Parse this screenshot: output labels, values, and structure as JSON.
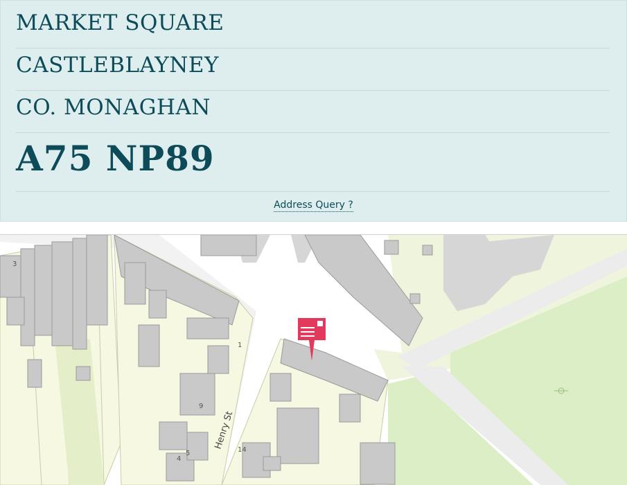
{
  "address": {
    "line1": "MARKET SQUARE",
    "line2": "CASTLEBLAYNEY",
    "line3": "CO. MONAGHAN",
    "eircode": "A75 NP89"
  },
  "query_link": "Address Query ?",
  "map": {
    "street_labels": [
      "Henry St"
    ],
    "building_numbers": [
      "3",
      "1",
      "9",
      "5",
      "4",
      "14"
    ],
    "marker_icon": "location-pin-icon",
    "colors": {
      "road": "#ffffff",
      "building": "#c9c9c9",
      "plot": "#f6f8e2",
      "green": "#dceec6",
      "marker": "#e23a5c"
    }
  }
}
